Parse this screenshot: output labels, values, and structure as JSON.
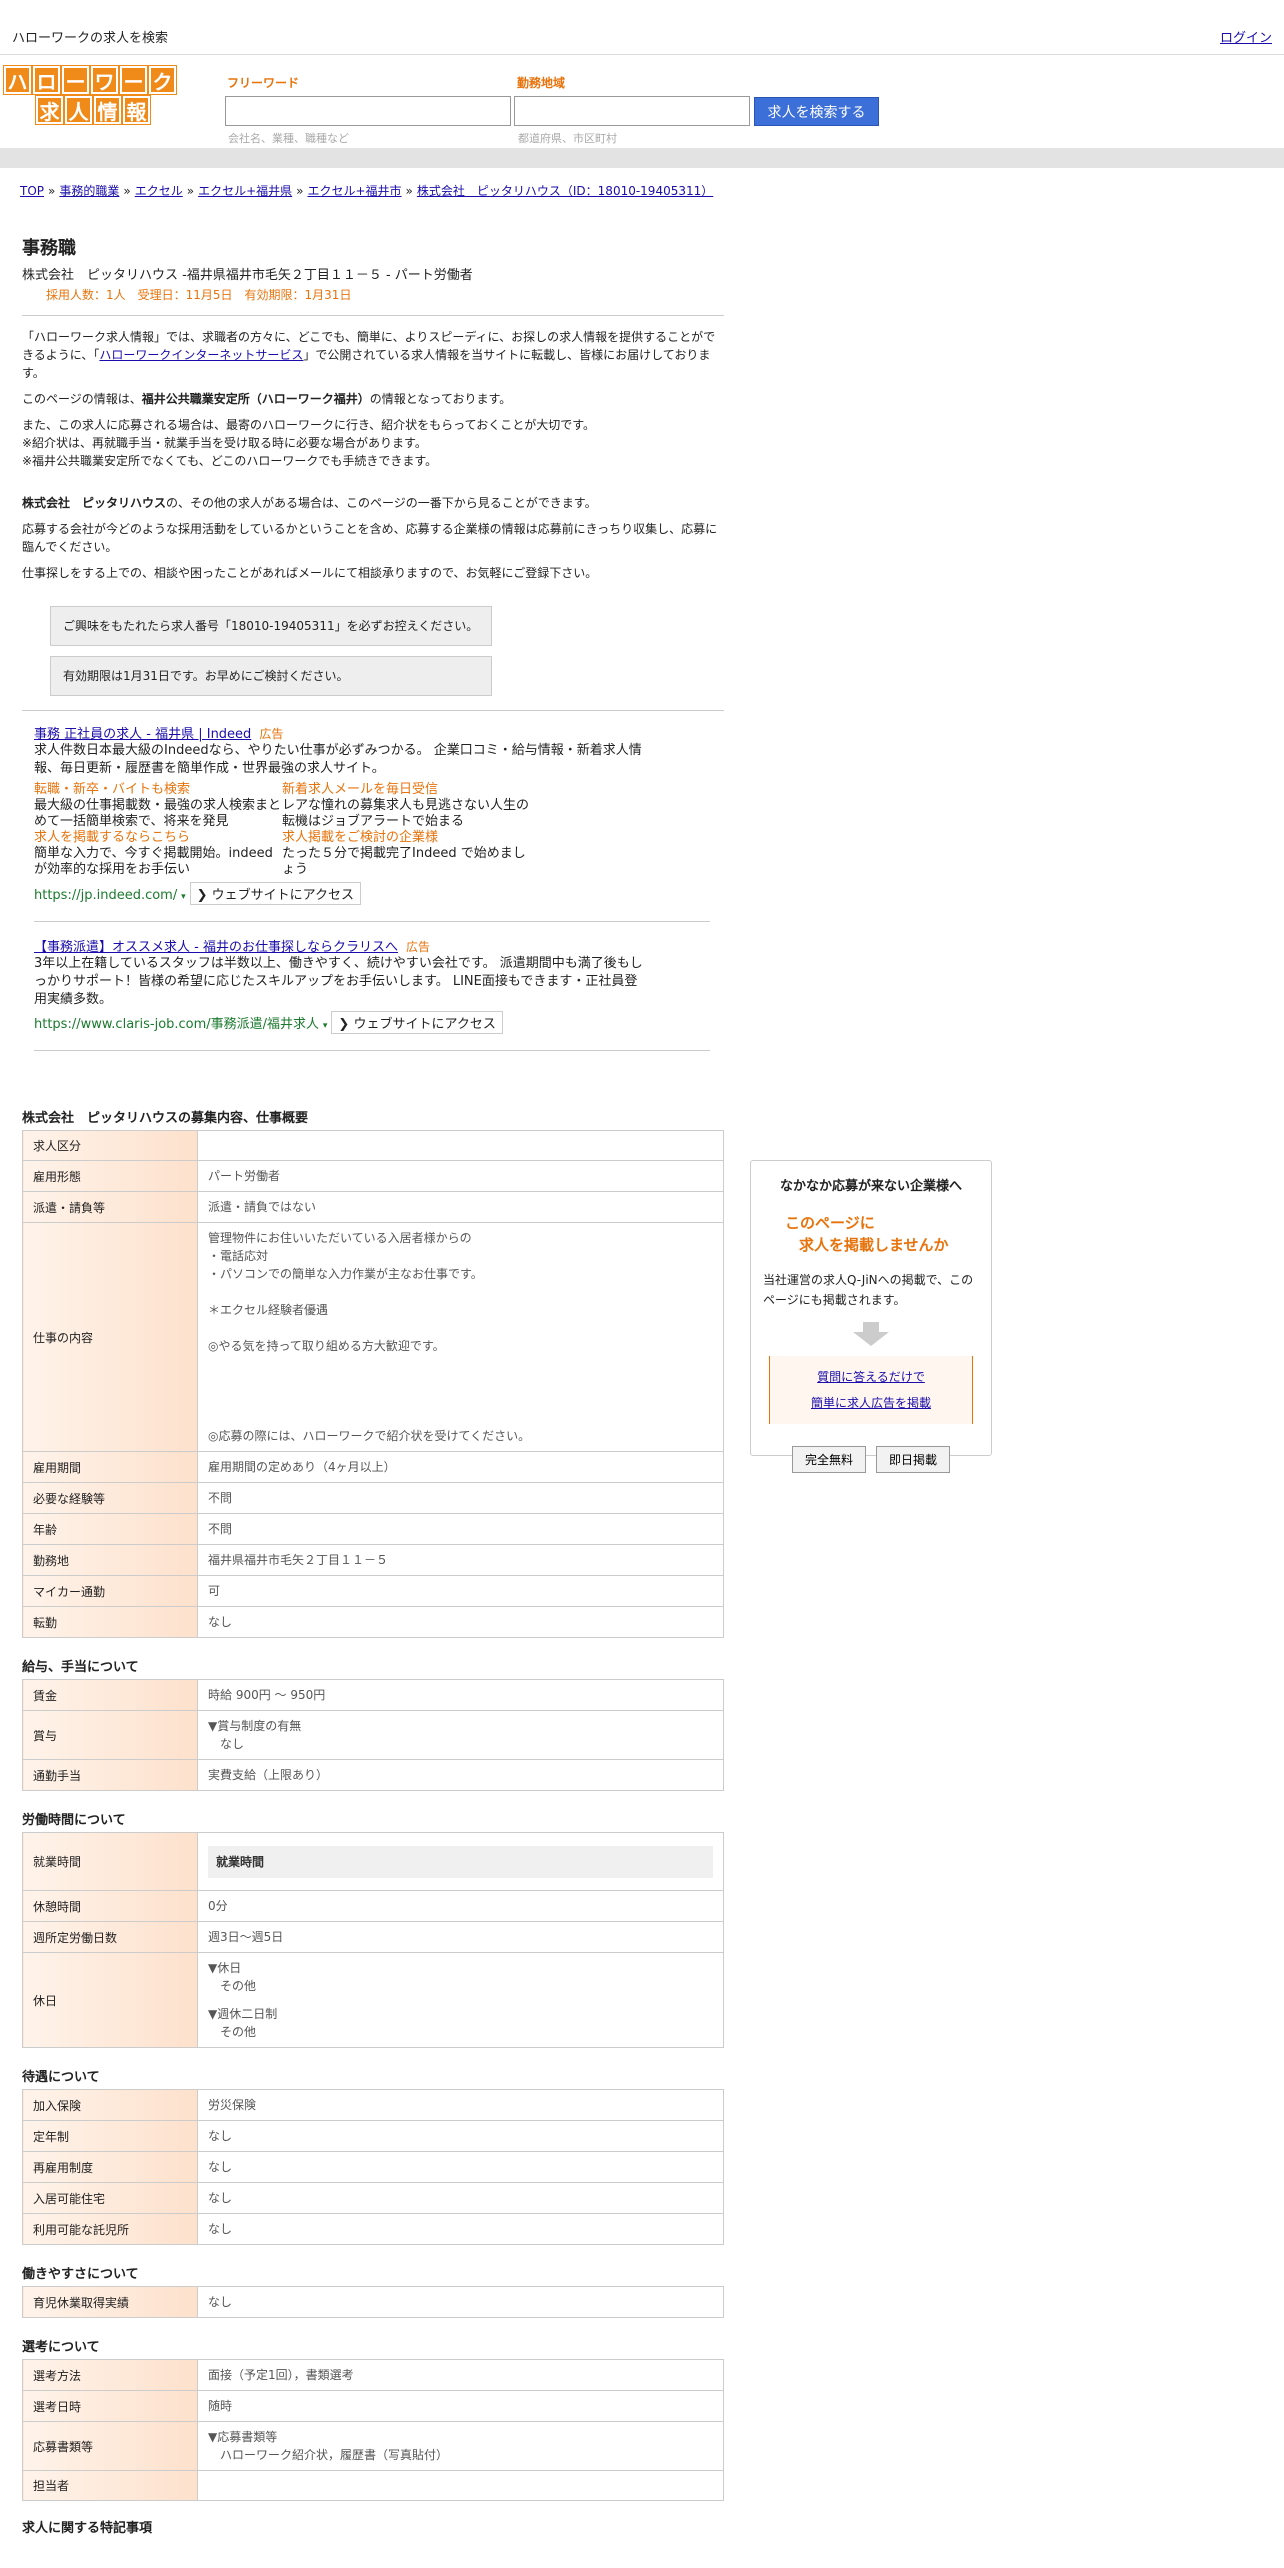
{
  "topbar": {
    "site_title": "ハローワークの求人を検索",
    "login": "ログイン"
  },
  "logo": {
    "row1": [
      "ハ",
      "ロ",
      "ー",
      "ワ",
      "ー",
      "ク"
    ],
    "row2": [
      "求",
      "人",
      "情",
      "報"
    ]
  },
  "search": {
    "freeword_label": "フリーワード",
    "freeword_hint": "会社名、業種、職種など",
    "area_label": "勤務地域",
    "area_hint": "都道府県、市区町村",
    "button": "求人を検索する"
  },
  "breadcrumb": [
    "TOP",
    "事務的職業",
    "エクセル",
    "エクセル+福井県",
    "エクセル+福井市",
    "株式会社　ピッタリハウス（ID：18010-19405311）"
  ],
  "job": {
    "title": "事務職",
    "company_line": "株式会社　ピッタリハウス -福井県福井市毛矢２丁目１１－５ - パート労働者",
    "meta": "採用人数：1人　受理日：11月5日　有効期限：1月31日"
  },
  "intro": {
    "p1a": "「ハローワーク求人情報」では、求職者の方々に、どこでも、簡単に、よりスピーディに、お探しの求人情報を提供することができるように、「",
    "p1link": "ハローワークインターネットサービス",
    "p1b": "」で公開されている求人情報を当サイトに転載し、皆様にお届けしております。",
    "p2a": "このページの情報は、",
    "p2b": "福井公共職業安定所（ハローワーク福井）",
    "p2c": "の情報となっております。",
    "p3": "また、この求人に応募される場合は、最寄のハローワークに行き、紹介状をもらっておくことが大切です。",
    "p4": "※紹介状は、再就職手当・就業手当を受け取る時に必要な場合があります。",
    "p5": "※福井公共職業安定所でなくても、どこのハローワークでも手続きできます。",
    "p6a": "株式会社　ピッタリハウス",
    "p6b": "の、その他の求人がある場合は、このページの一番下から見ることができます。",
    "p7": "応募する会社が今どのような採用活動をしているかということを含め、応募する企業様の情報は応募前にきっちり収集し、応募に臨んでください。",
    "p8": "仕事探しをする上での、相談や困ったことがあればメールにて相談承りますので、お気軽にご登録下さい。"
  },
  "notices": {
    "n1": "ご興味をもたれたら求人番号「18010-19405311」を必ずお控えください。",
    "n2": "有効期限は1月31日です。お早めにご検討ください。"
  },
  "ads": {
    "a1": {
      "title": "事務 正社員の求人 - 福井県 | Indeed",
      "badge": "広告",
      "text": "求人件数日本最大級のIndeedなら、やりたい仕事が必ずみつかる。 企業口コミ・給与情報・新着求人情報、毎日更新・履歴書を簡単作成・世界最強の求人サイト。",
      "sl1_head": "転職・新卒・バイトも検索",
      "sl1_text": "最大級の仕事掲載数・最強の求人検索まとめて一括簡単検索で、将来を発見",
      "sl2_head": "新着求人メールを毎日受信",
      "sl2_text": "レアな憧れの募集求人も見逃さない人生の転機はジョブアラートで始まる",
      "sl3_head": "求人を掲載するならこちら",
      "sl3_text": "簡単な入力で、今すぐ掲載開始。indeedが効率的な採用をお手伝い",
      "sl4_head": "求人掲載をご検討の企業様",
      "sl4_text": "たった５分で掲載完了Indeed で始めましょう",
      "url": "https://jp.indeed.com/",
      "visit": "ウェブサイトにアクセス"
    },
    "a2": {
      "title": "【事務派遣】オススメ求人 - 福井のお仕事探しならクラリスへ",
      "badge": "広告",
      "text": "3年以上在籍しているスタッフは半数以上、働きやすく、続けやすい会社です。 派遣期間中も満了後もしっかりサポート！皆様の希望に応じたスキルアップをお手伝いします。 LINE面接もできます・正社員登用実績多数。",
      "url": "https://www.claris-job.com/事務派遣/福井求人",
      "visit": "ウェブサイトにアクセス"
    }
  },
  "sections": {
    "overview": "株式会社　ピッタリハウスの募集内容、仕事概要",
    "salary": "給与、手当について",
    "hours": "労働時間について",
    "benefits": "待遇について",
    "work_ease": "働きやすさについて",
    "selection": "選考について",
    "special": "求人に関する特記事項"
  },
  "overview_rows": [
    {
      "label": "求人区分",
      "value": ""
    },
    {
      "label": "雇用形態",
      "value": "パート労働者"
    },
    {
      "label": "派遣・請負等",
      "value": "派遣・請負ではない"
    },
    {
      "label": "雇用期間",
      "value": "雇用期間の定めあり（4ヶ月以上）"
    },
    {
      "label": "必要な経験等",
      "value": "不問"
    },
    {
      "label": "年齢",
      "value": "不問"
    },
    {
      "label": "勤務地",
      "value": "福井県福井市毛矢２丁目１１－５"
    },
    {
      "label": "マイカー通勤",
      "value": "可"
    },
    {
      "label": "転勤",
      "value": "なし"
    }
  ],
  "job_content": {
    "label": "仕事の内容",
    "l1": "管理物件にお住いいただいている入居者様からの",
    "l2": "・電話応対",
    "l3": "・パソコンでの簡単な入力作業が主なお仕事です。",
    "l4": "＊エクセル経験者優遇",
    "l5": "◎やる気を持って取り組める方大歓迎です。",
    "l6": "◎応募の際には、ハローワークで紹介状を受けてください。"
  },
  "salary_rows": {
    "wage_label": "賃金",
    "wage": "時給 900円 ～ 950円",
    "bonus_label": "賞与",
    "bonus1": "▼賞与制度の有無",
    "bonus2": "なし",
    "commute_label": "通勤手当",
    "commute": "実費支給（上限あり）"
  },
  "hours_rows": {
    "work_label": "就業時間",
    "work_sub": "就業時間",
    "break_label": "休憩時間",
    "break": "0分",
    "days_label": "週所定労働日数",
    "days": "週3日〜週5日",
    "holiday_label": "休日",
    "h1": "▼休日",
    "h2": "その他",
    "h3": "▼週休二日制",
    "h4": "その他"
  },
  "benefit_rows": [
    {
      "label": "加入保険",
      "value": "労災保険"
    },
    {
      "label": "定年制",
      "value": "なし"
    },
    {
      "label": "再雇用制度",
      "value": "なし"
    },
    {
      "label": "入居可能住宅",
      "value": "なし"
    },
    {
      "label": "利用可能な託児所",
      "value": "なし"
    }
  ],
  "work_ease_rows": [
    {
      "label": "育児休業取得実績",
      "value": "なし"
    }
  ],
  "selection_rows": {
    "method_label": "選考方法",
    "method": "面接（予定1回），書類選考",
    "date_label": "選考日時",
    "date": "随時",
    "docs_label": "応募書類等",
    "docs1": "▼応募書類等",
    "docs2": "ハローワーク紹介状，履歴書（写真貼付）",
    "contact_label": "担当者",
    "contact": ""
  },
  "side": {
    "title": "なかなか応募が来ない企業様へ",
    "orange1": "このページに",
    "orange2": "求人を掲載しませんか",
    "desc": "当社運営の求人Q-JiNへの掲載で、このページにも掲載されます。",
    "link1": "質問に答えるだけで",
    "link2": "簡単に求人広告を掲載",
    "btn1": "完全無料",
    "btn2": "即日掲載"
  },
  "colors": {
    "accent": "#e8730c",
    "button_blue": "#3d6fd8",
    "ad_url_green": "#1a7a2e"
  }
}
